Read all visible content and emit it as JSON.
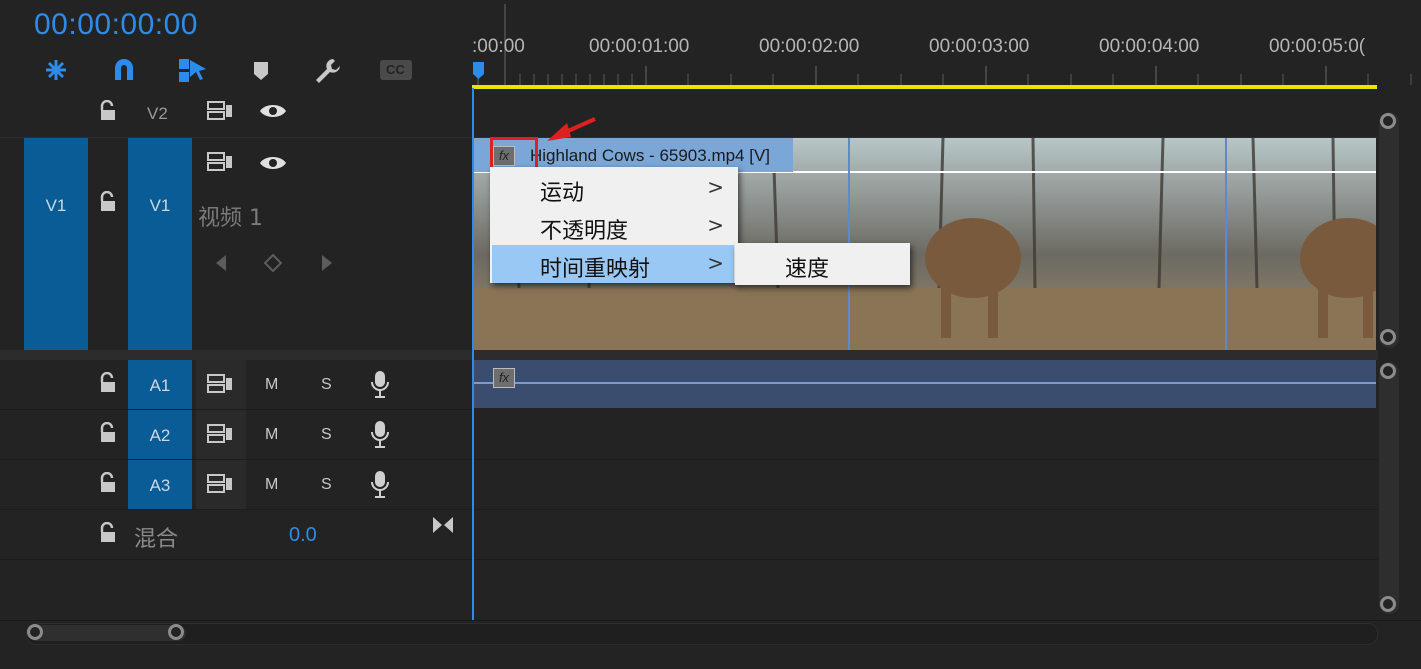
{
  "timecode": "00:00:00:00",
  "toolbar": {
    "tools": [
      "nest-icon",
      "snap-magnet-icon",
      "linked-selection-icon",
      "marker-icon",
      "wrench-icon",
      "captions-icon"
    ],
    "captions_label": "CC"
  },
  "ruler": {
    "labels": [
      ":00:00",
      "00:00:01:00",
      "00:00:02:00",
      "00:00:03:00",
      "00:00:04:00",
      "00:00:05:0("
    ]
  },
  "tracks": {
    "v2": {
      "target": "V2"
    },
    "v1": {
      "source": "V1",
      "target": "V1",
      "name": "视频 1"
    },
    "a1": {
      "target": "A1",
      "mute": "M",
      "solo": "S"
    },
    "a2": {
      "target": "A2",
      "mute": "M",
      "solo": "S"
    },
    "a3": {
      "target": "A3",
      "mute": "M",
      "solo": "S"
    },
    "mix": {
      "label": "混合",
      "value": "0.0"
    }
  },
  "clip": {
    "fx_label": "fx",
    "name": "Highland Cows - 65903.mp4 [V]"
  },
  "audio_clip": {
    "fx_label": "fx"
  },
  "context_menu": {
    "items": [
      {
        "label": "运动",
        "arrow": ">"
      },
      {
        "label": "不透明度",
        "arrow": ">"
      },
      {
        "label": "时间重映射",
        "arrow": ">"
      }
    ],
    "submenu": {
      "items": [
        {
          "label": "速度"
        }
      ]
    }
  },
  "colors": {
    "accent": "#2d8ceb",
    "track_target": "#0a5c96",
    "clip_video": "#7aa6d8",
    "clip_audio": "#3a4d6e",
    "work_area": "#e6e600",
    "highlight_box": "#e02020"
  }
}
